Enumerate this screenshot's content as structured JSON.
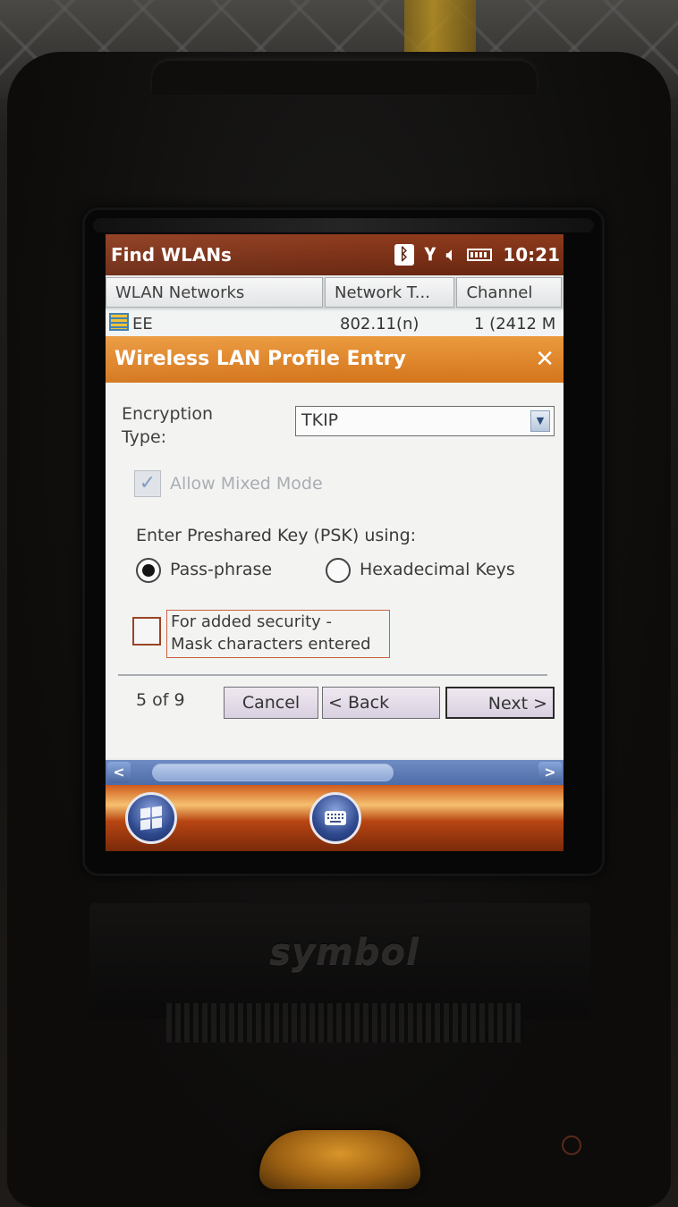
{
  "title_bar": {
    "title": "Find WLANs",
    "time": "10:21",
    "icons": [
      "bluetooth-icon",
      "signal-antenna-icon",
      "speaker-icon",
      "battery-icon"
    ]
  },
  "wlan_list": {
    "columns": [
      "WLAN Networks",
      "Network T...",
      "Channel"
    ],
    "rows": [
      {
        "name": "EE",
        "network_type": "802.11(n)",
        "channel": "1 (2412 M"
      }
    ]
  },
  "dialog": {
    "title": "Wireless LAN Profile Entry",
    "close_glyph": "✕",
    "encryption_label": "Encryption\n Type:",
    "encryption_value": "TKIP",
    "allow_mixed_mode_label": "Allow Mixed Mode",
    "allow_mixed_mode_checked": true,
    "allow_mixed_mode_enabled": false,
    "psk_label": "Enter Preshared Key (PSK) using:",
    "psk_options": [
      {
        "label": "Pass-phrase",
        "selected": true
      },
      {
        "label": "Hexadecimal Keys",
        "selected": false
      }
    ],
    "mask_label_line1": "For added security -",
    "mask_label_line2": "Mask characters entered",
    "mask_checked": false,
    "step": "5 of 9",
    "buttons": {
      "cancel": "Cancel",
      "back": "< Back",
      "next": "Next >"
    }
  },
  "scrollbar": {
    "left_glyph": "<",
    "right_glyph": ">"
  },
  "taskbar": {
    "buttons": [
      "windows-start-icon",
      "keyboard-icon"
    ]
  },
  "device": {
    "brand": "symbol"
  },
  "colors": {
    "title_bar": "#8e3a1c",
    "dialog_header": "#e08a30",
    "button_face": "#e4dce8",
    "scrollbar": "#5a78b4",
    "taskbar": "#c4501a"
  }
}
